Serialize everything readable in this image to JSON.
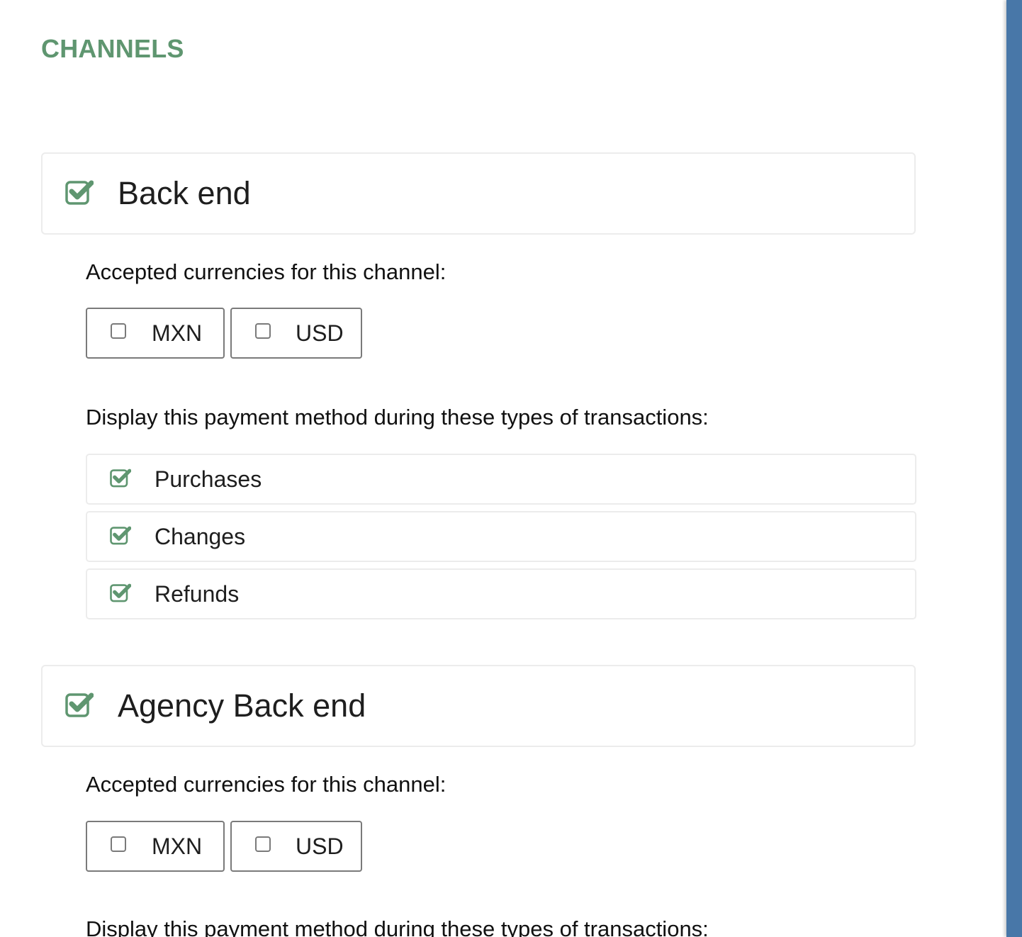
{
  "section_title": "CHANNELS",
  "colors": {
    "accent_green": "#5f9670",
    "side_rail_blue": "#4877a8"
  },
  "channels": [
    {
      "name": "Back end",
      "checked": true,
      "currencies_label": "Accepted currencies for this channel:",
      "currencies": [
        {
          "code": "MXN",
          "checked": false
        },
        {
          "code": "USD",
          "checked": false
        }
      ],
      "transactions_label": "Display this payment method during these types of transactions:",
      "transactions": [
        {
          "label": "Purchases",
          "checked": true
        },
        {
          "label": "Changes",
          "checked": true
        },
        {
          "label": "Refunds",
          "checked": true
        }
      ]
    },
    {
      "name": "Agency Back end",
      "checked": true,
      "currencies_label": "Accepted currencies for this channel:",
      "currencies": [
        {
          "code": "MXN",
          "checked": false
        },
        {
          "code": "USD",
          "checked": false
        }
      ],
      "transactions_label": "Display this payment method during these types of transactions:"
    }
  ],
  "icons": {
    "checked": "checkbox-checked-icon",
    "unchecked": "checkbox-unchecked-icon"
  }
}
